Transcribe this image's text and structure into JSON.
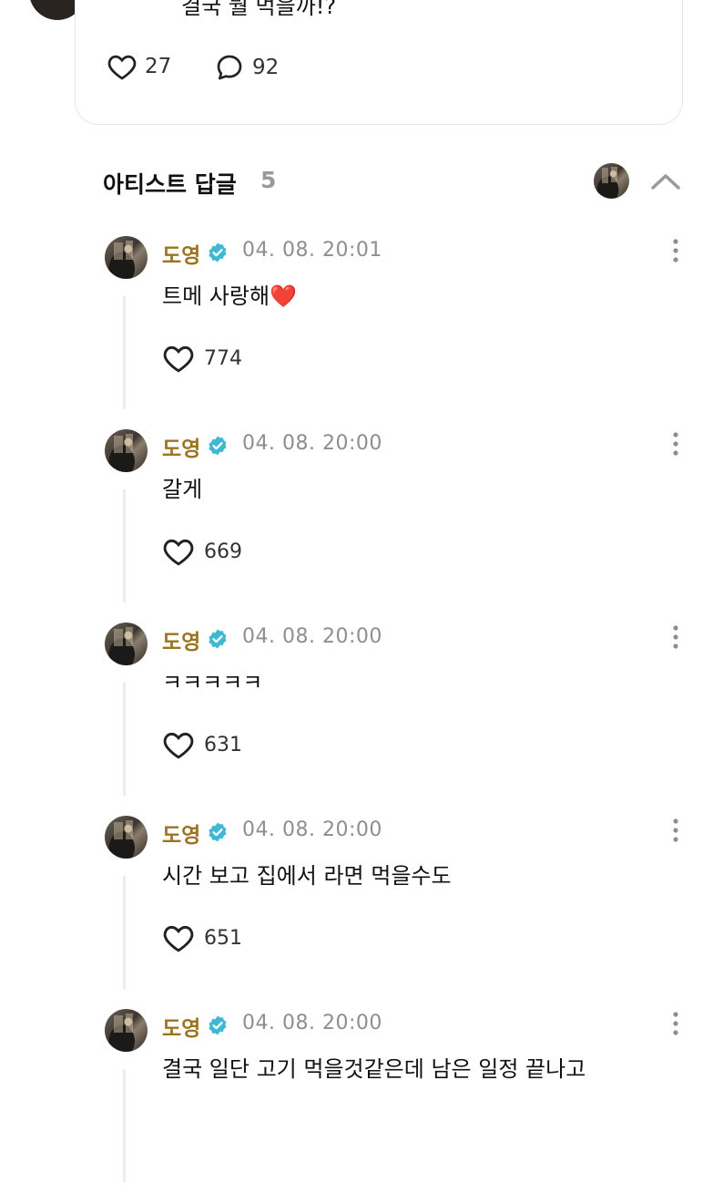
{
  "post": {
    "text": "결국 뭘 먹을까!?",
    "like_count": "27",
    "comment_count": "92"
  },
  "section": {
    "title": "아티스트 답글",
    "count": "5"
  },
  "replies": [
    {
      "name": "도영",
      "time": "04. 08. 20:01",
      "text": "트메 사랑해❤️",
      "likes": "774"
    },
    {
      "name": "도영",
      "time": "04. 08. 20:00",
      "text": "갈게",
      "likes": "669"
    },
    {
      "name": "도영",
      "time": "04. 08. 20:00",
      "text": "ㅋㅋㅋㅋㅋ",
      "likes": "631"
    },
    {
      "name": "도영",
      "time": "04. 08. 20:00",
      "text": "시간 보고 집에서 라면 먹을수도",
      "likes": "651"
    },
    {
      "name": "도영",
      "time": "04. 08. 20:00",
      "text": "결국 일단 고기 먹을것같은데 남은 일정 끝나고",
      "likes": ""
    }
  ],
  "colors": {
    "name": "#9c7420",
    "verified": "#3fb8d6",
    "muted": "#8e8e8e"
  },
  "icons": {
    "like": "heart-icon",
    "comment": "speech-bubble-icon",
    "verified": "verified-badge-icon",
    "more": "more-vertical-icon",
    "collapse": "chevron-up-icon"
  }
}
